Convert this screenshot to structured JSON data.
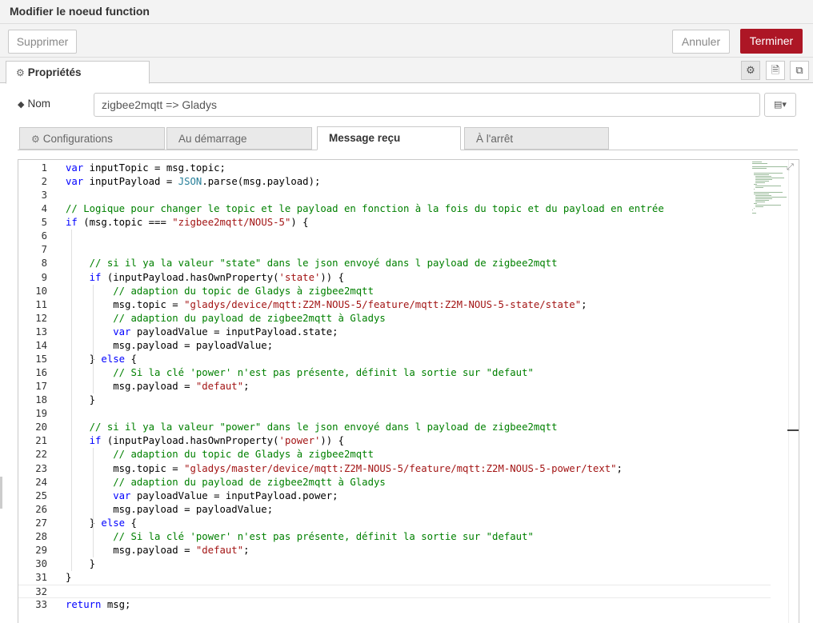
{
  "dialog": {
    "title": "Modifier le noeud function"
  },
  "buttons": {
    "delete": "Supprimer",
    "cancel": "Annuler",
    "done": "Terminer"
  },
  "tabs": {
    "properties": "Propriétés"
  },
  "name_field": {
    "label": "Nom",
    "value": "zigbee2mqtt => Gladys"
  },
  "subtabs": [
    {
      "label": "Configurations"
    },
    {
      "label": "Au démarrage"
    },
    {
      "label": "Message reçu"
    },
    {
      "label": "À l'arrêt"
    }
  ],
  "code": {
    "line_numbers": [
      "1",
      "2",
      "3",
      "4",
      "5",
      "6",
      "7",
      "8",
      "9",
      "10",
      "11",
      "12",
      "13",
      "14",
      "15",
      "16",
      "17",
      "18",
      "19",
      "20",
      "21",
      "22",
      "23",
      "24",
      "25",
      "26",
      "27",
      "28",
      "29",
      "30",
      "31",
      "32",
      "33"
    ],
    "lines": [
      "var inputTopic = msg.topic;",
      "var inputPayload = JSON.parse(msg.payload);",
      "",
      "// Logique pour changer le topic et le payload en fonction à la fois du topic et du payload en entrée",
      "if (msg.topic === \"zigbee2mqtt/NOUS-5\") {",
      "",
      "",
      "    // si il ya la valeur \"state\" dans le json envoyé dans l payload de zigbee2mqtt",
      "    if (inputPayload.hasOwnProperty('state')) {",
      "        // adaption du topic de Gladys à zigbee2mqtt",
      "        msg.topic = \"gladys/device/mqtt:Z2M-NOUS-5/feature/mqtt:Z2M-NOUS-5-state/state\";",
      "        // adaption du payload de zigbee2mqtt à Gladys",
      "        var payloadValue = inputPayload.state;",
      "        msg.payload = payloadValue;",
      "    } else {",
      "        // Si la clé 'power' n'est pas présente, définit la sortie sur \"defaut\"",
      "        msg.payload = \"defaut\";",
      "    }",
      "",
      "    // si il ya la valeur \"power\" dans le json envoyé dans l payload de zigbee2mqtt",
      "    if (inputPayload.hasOwnProperty('power')) {",
      "        // adaption du topic de Gladys à zigbee2mqtt",
      "        msg.topic = \"gladys/master/device/mqtt:Z2M-NOUS-5/feature/mqtt:Z2M-NOUS-5-power/text\";",
      "        // adaption du payload de zigbee2mqtt à Gladys",
      "        var payloadValue = inputPayload.power;",
      "        msg.payload = payloadValue;",
      "    } else {",
      "        // Si la clé 'power' n'est pas présente, définit la sortie sur \"defaut\"",
      "        msg.payload = \"defaut\";",
      "    }",
      "}",
      "",
      "return msg;"
    ]
  },
  "colors": {
    "done_button": "#ad1625",
    "keyword": "#0000ff",
    "string": "#a31515",
    "comment": "#008000"
  },
  "icons": [
    "gear-icon",
    "document-icon",
    "layout-icon",
    "tag-icon",
    "book-icon",
    "expand-icon"
  ]
}
